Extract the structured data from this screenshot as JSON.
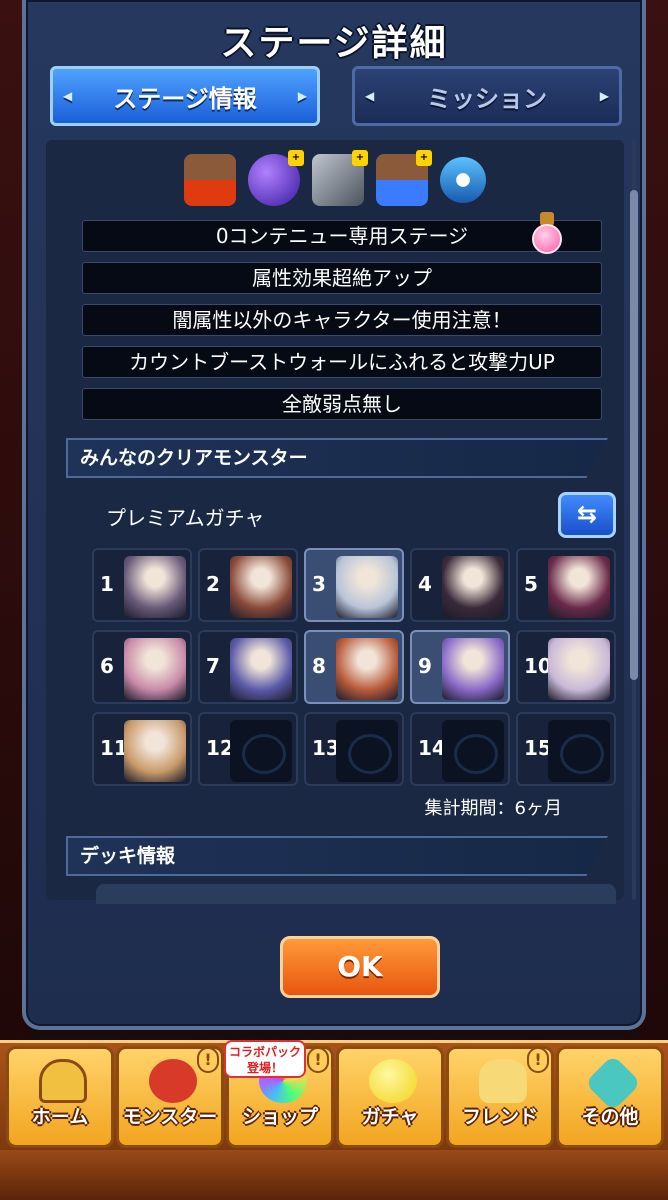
{
  "dialog": {
    "title": "ステージ詳細",
    "tabs": [
      {
        "label": "ステージ情報",
        "active": true
      },
      {
        "label": "ミッション",
        "active": false
      }
    ]
  },
  "gimmicks": [
    {
      "icon": "damage-wall-icon",
      "badge": ""
    },
    {
      "icon": "gravity-orb-icon",
      "badge": "+"
    },
    {
      "icon": "block-icon",
      "badge": "+"
    },
    {
      "icon": "counter-wall-icon",
      "badge": "+"
    },
    {
      "icon": "speed-down-icon",
      "badge": ""
    }
  ],
  "stage_info": [
    "0コンテニュー専用ステージ",
    "属性効果超絶アップ",
    "闇属性以外のキャラクター使用注意！",
    "カウントブーストウォールにふれると攻撃力UP",
    "全敵弱点無し"
  ],
  "clear_monsters": {
    "section_title": "みんなのクリアモンスター",
    "gacha_label": "プレミアムガチャ",
    "swap_label": "⇆",
    "entries": [
      {
        "rank": "1",
        "highlight": false,
        "empty": false,
        "color": "#6a5a7a"
      },
      {
        "rank": "2",
        "highlight": false,
        "empty": false,
        "color": "#8a4a3a"
      },
      {
        "rank": "3",
        "highlight": true,
        "empty": false,
        "color": "#b8c4d8"
      },
      {
        "rank": "4",
        "highlight": false,
        "empty": false,
        "color": "#3a2a3a"
      },
      {
        "rank": "5",
        "highlight": false,
        "empty": false,
        "color": "#6a2a4a"
      },
      {
        "rank": "6",
        "highlight": false,
        "empty": false,
        "color": "#c88aa8"
      },
      {
        "rank": "7",
        "highlight": false,
        "empty": false,
        "color": "#5a5aa8"
      },
      {
        "rank": "8",
        "highlight": true,
        "empty": false,
        "color": "#b85a3a"
      },
      {
        "rank": "9",
        "highlight": true,
        "empty": false,
        "color": "#8a6ac8"
      },
      {
        "rank": "10",
        "highlight": false,
        "empty": false,
        "color": "#c8b8d8"
      },
      {
        "rank": "11",
        "highlight": false,
        "empty": false,
        "color": "#c89a6a"
      },
      {
        "rank": "12",
        "highlight": false,
        "empty": true,
        "color": ""
      },
      {
        "rank": "13",
        "highlight": false,
        "empty": true,
        "color": ""
      },
      {
        "rank": "14",
        "highlight": false,
        "empty": true,
        "color": ""
      },
      {
        "rank": "15",
        "highlight": false,
        "empty": true,
        "color": ""
      }
    ],
    "period": "集計期間：6ヶ月"
  },
  "deck": {
    "section_title": "デッキ情報"
  },
  "ok_label": "OK",
  "nav": [
    {
      "label": "ホーム",
      "icon": "home-icon",
      "badge": ""
    },
    {
      "label": "モンスター",
      "icon": "monster-icon",
      "badge": "!"
    },
    {
      "label": "ショップ",
      "icon": "shop-icon",
      "badge": "!"
    },
    {
      "label": "ガチャ",
      "icon": "gacha-icon",
      "badge": ""
    },
    {
      "label": "フレンド",
      "icon": "friend-icon",
      "badge": "!"
    },
    {
      "label": "その他",
      "icon": "other-icon",
      "badge": ""
    }
  ],
  "collab_tag": "コラボパック\n登場！"
}
